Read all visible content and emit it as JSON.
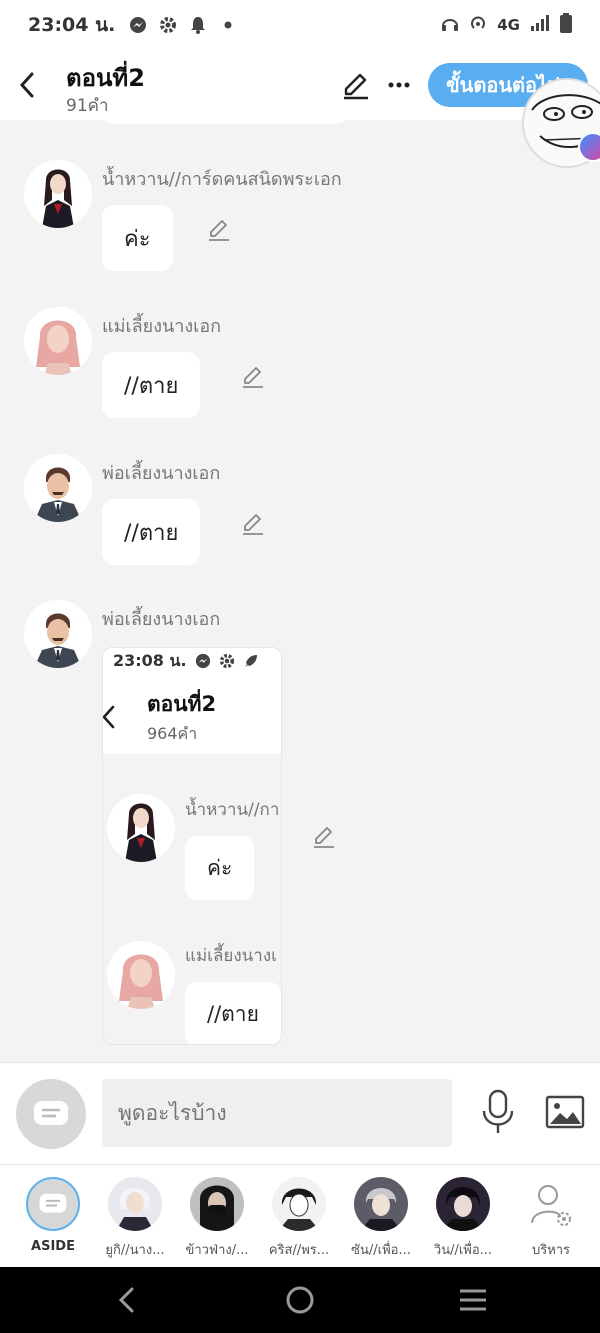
{
  "status_bar": {
    "time": "23:04 น.",
    "network": "4G",
    "icons": [
      "messenger-icon",
      "gear-icon",
      "bell-icon",
      "dot-icon",
      "headphones-icon",
      "hotspot-icon",
      "signal-icon",
      "battery-icon"
    ]
  },
  "header": {
    "title": "ตอนที่2",
    "word_count": "91คำ",
    "next_label": "ขั้นตอนต่อไป"
  },
  "messages": [
    {
      "speaker": "น้ำหวาน//การ์ดคนสนิดพระเอก",
      "text": "ค่ะ",
      "avatar": "dark-hair-girl-avatar"
    },
    {
      "speaker": "แม่เลี้ยงนางเอก",
      "text": "//ตาย",
      "avatar": "pink-hair-woman-avatar"
    },
    {
      "speaker": "พ่อเลี้ยงนางเอก",
      "text": "//ตาย",
      "avatar": "mustache-man-avatar"
    },
    {
      "speaker": "พ่อเลี้ยงนางเอก",
      "text": "",
      "avatar": "mustache-man-avatar"
    }
  ],
  "embedded_screenshot": {
    "time": "23:08 น.",
    "title": "ตอนที่2",
    "word_count": "964คำ",
    "messages": [
      {
        "speaker": "น้ำหวาน//กา",
        "text": "ค่ะ"
      },
      {
        "speaker": "แม่เลี้ยงนางเ",
        "text": "//ตาย"
      }
    ]
  },
  "input": {
    "placeholder": "พูดอะไรบ้าง"
  },
  "characters": [
    {
      "label": "ASIDE"
    },
    {
      "label": "ยูกิ//นาง..."
    },
    {
      "label": "ข้าวฟ่าง/..."
    },
    {
      "label": "คริส//พร..."
    },
    {
      "label": "ซัน//เพื่อ..."
    },
    {
      "label": "วิน//เพื่อ..."
    },
    {
      "label": "บริหาร"
    }
  ],
  "colors": {
    "accent": "#58aef0",
    "background": "#f3f3f3",
    "bubble": "#ffffff"
  }
}
